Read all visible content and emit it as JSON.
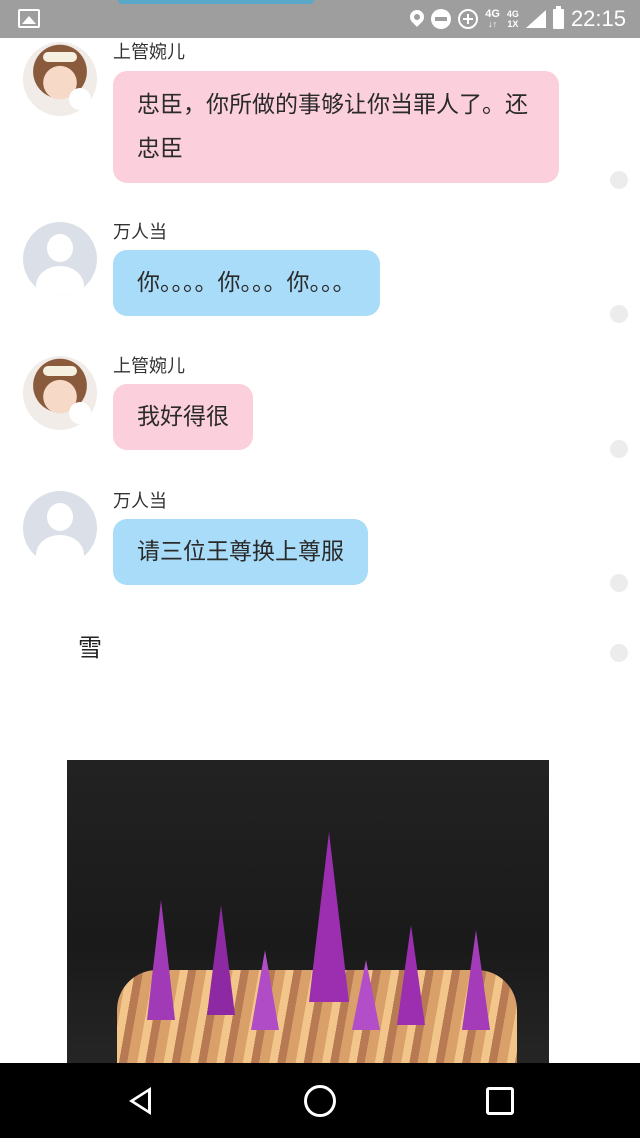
{
  "status_bar": {
    "time": "22:15",
    "network_top": "4G",
    "network_small": "4G",
    "network_sub": "1X",
    "icons": [
      "gallery-icon",
      "location-icon",
      "do-not-disturb-icon",
      "data-saver-icon",
      "signal-icon",
      "battery-icon"
    ]
  },
  "messages": [
    {
      "sender": "上管婉儿",
      "text": "忠臣，你所做的事够让你当罪人了。还忠臣",
      "color": "pink"
    },
    {
      "sender": "万人当",
      "text": "你。。。。你。。。你。。。",
      "color": "blue"
    },
    {
      "sender": "上管婉儿",
      "text": "我好得很",
      "color": "pink"
    },
    {
      "sender": "万人当",
      "text": "请三位王尊换上尊服",
      "color": "blue"
    }
  ],
  "plain_text": "雪",
  "colors": {
    "pink_bubble": "#fbcfdc",
    "blue_bubble": "#a9dcf8",
    "status_bar": "#9e9e9e",
    "nav_bar": "#000000"
  },
  "nav_bar": {
    "icons": [
      "back-icon",
      "home-icon",
      "recent-apps-icon"
    ]
  }
}
